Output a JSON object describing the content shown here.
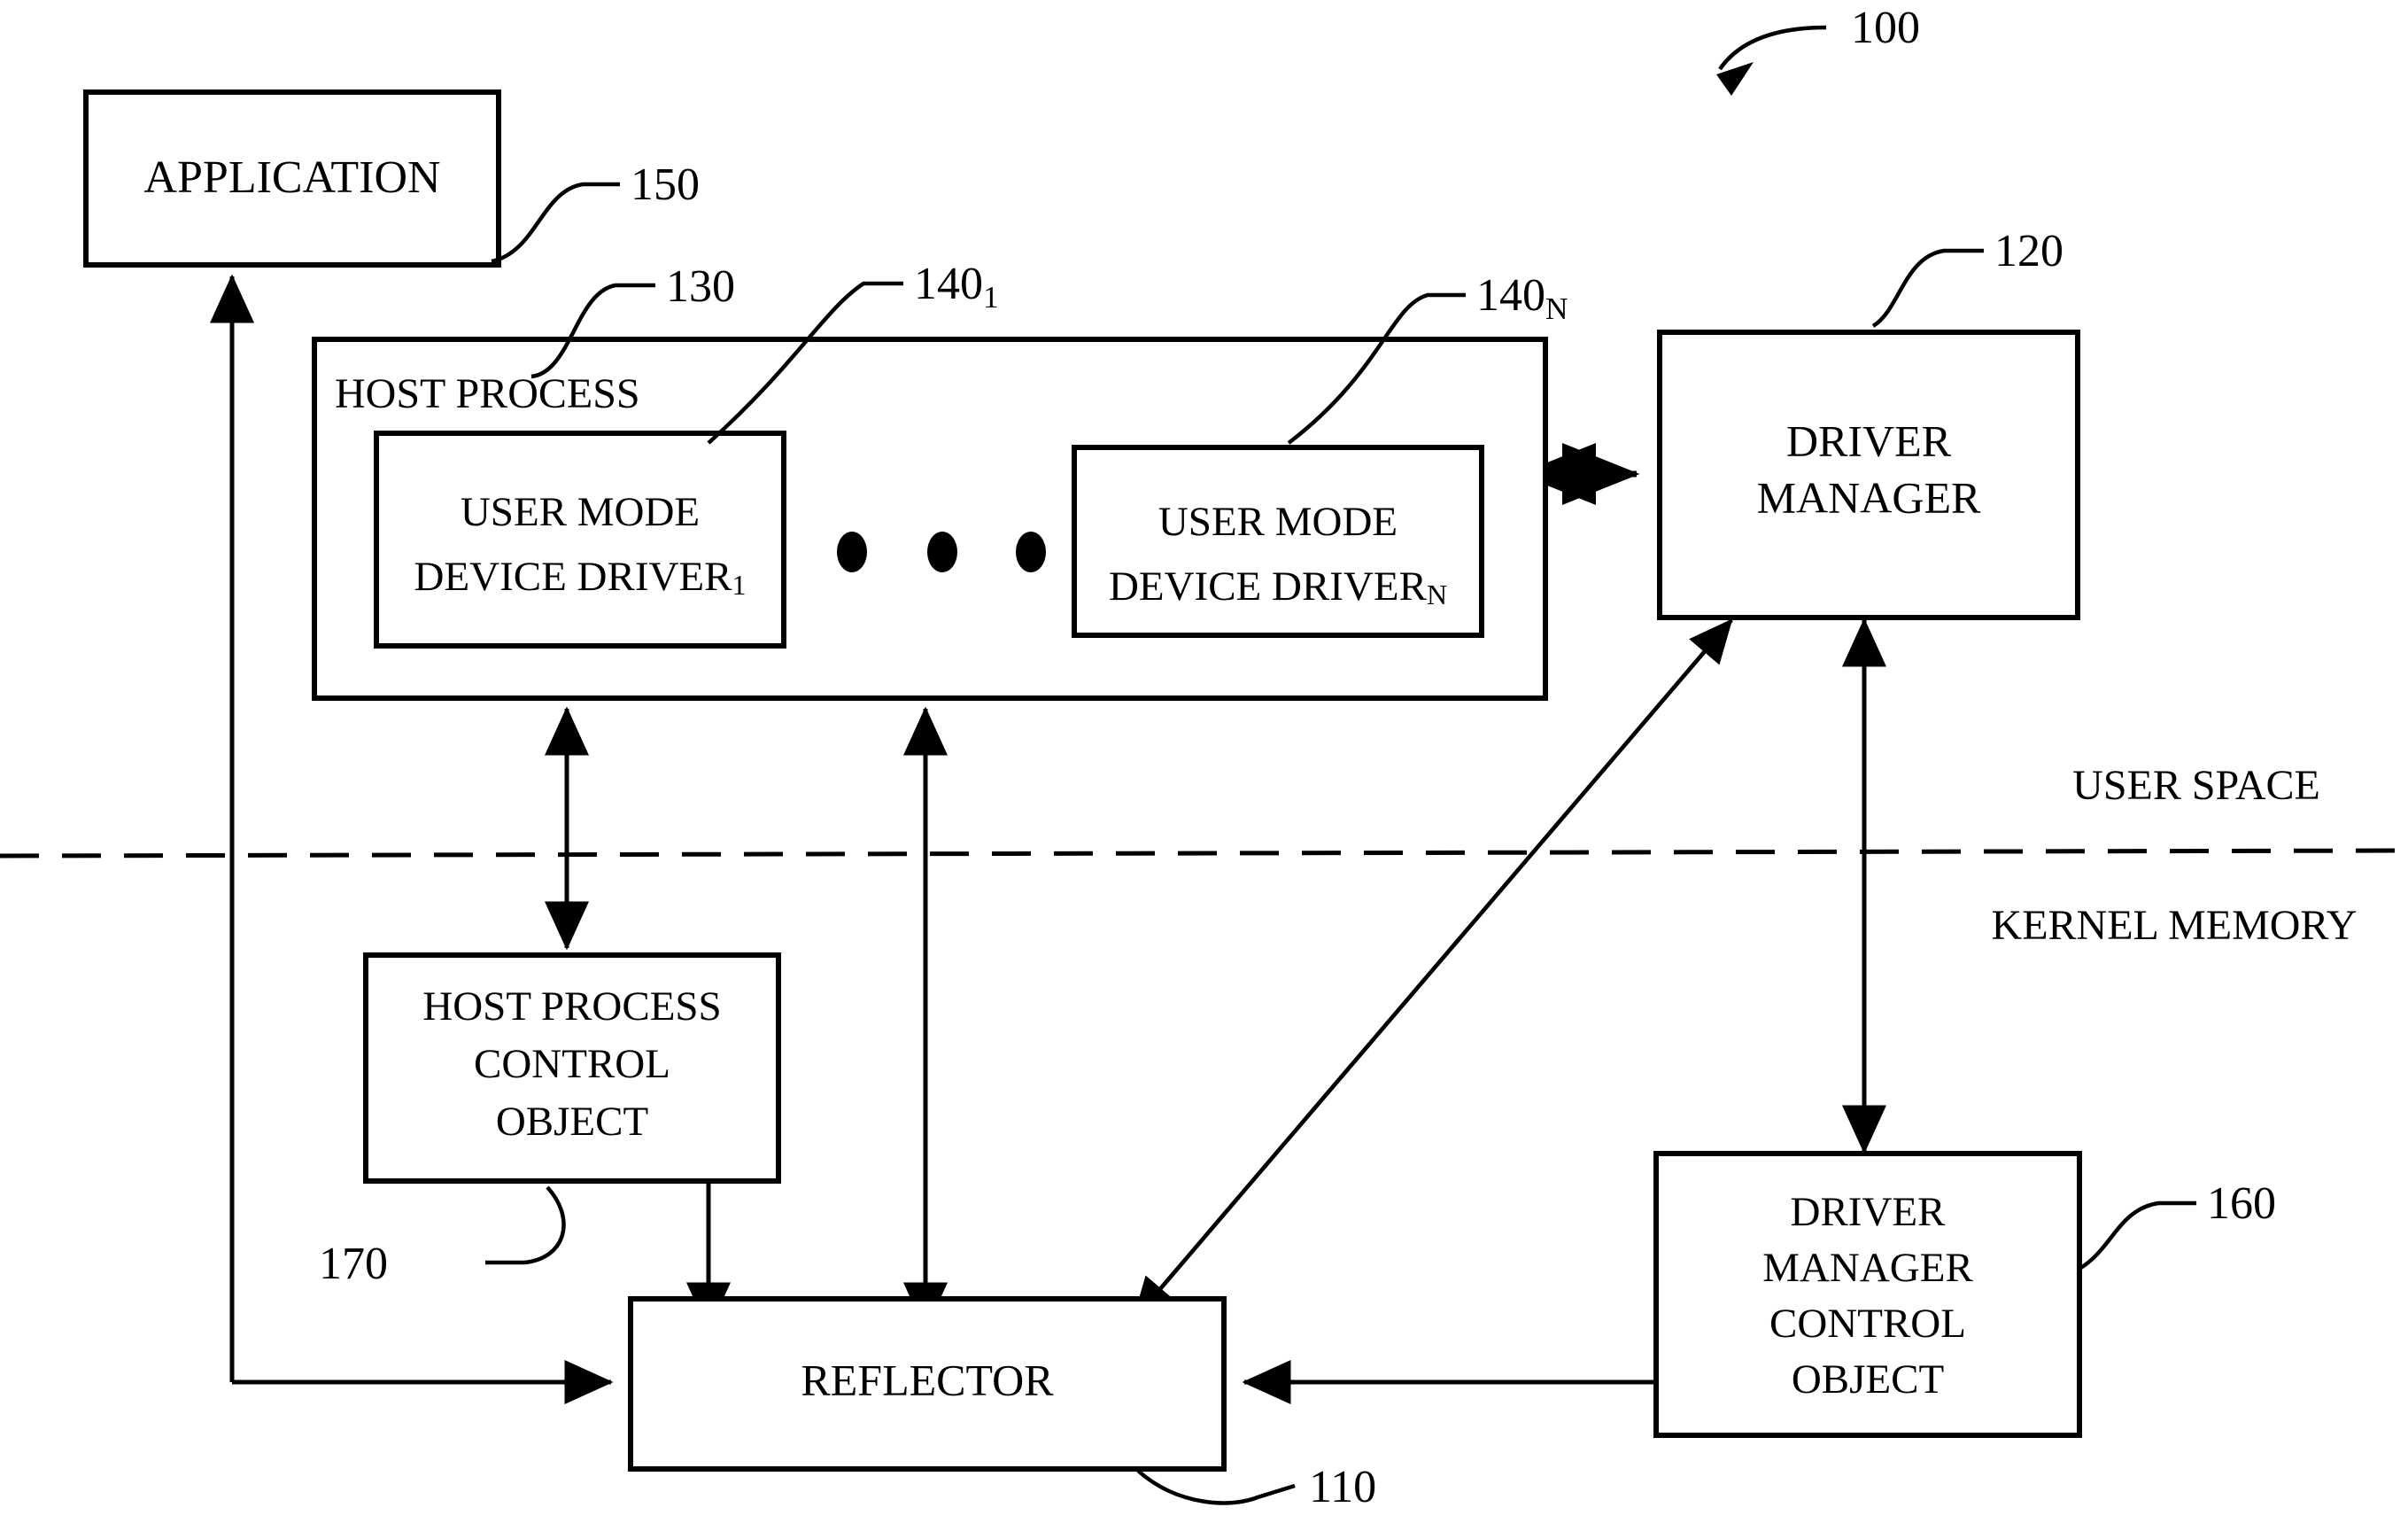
{
  "figure": {
    "figure_number": "100",
    "title": "",
    "boxes": {
      "application": {
        "label": "APPLICATION",
        "ref": "150"
      },
      "host_process": {
        "label": "HOST PROCESS",
        "ref": "130"
      },
      "user_mode_device_driver_1": {
        "label_line1": "USER MODE",
        "label_line2": "DEVICE DRIVER",
        "subscript": "1",
        "ref": "140",
        "ref_subscript": "1"
      },
      "user_mode_device_driver_n": {
        "label_line1": "USER MODE",
        "label_line2": "DEVICE DRIVER",
        "subscript": "N",
        "ref": "140",
        "ref_subscript": "N"
      },
      "driver_manager": {
        "label_line1": "DRIVER",
        "label_line2": "MANAGER",
        "ref": "120"
      },
      "host_process_control_object": {
        "label_line1": "HOST PROCESS",
        "label_line2": "CONTROL",
        "label_line3": "OBJECT",
        "ref": "170"
      },
      "reflector": {
        "label": "REFLECTOR",
        "ref": "110"
      },
      "driver_manager_control_object": {
        "label_line1": "DRIVER",
        "label_line2": "MANAGER",
        "label_line3": "CONTROL",
        "label_line4": "OBJECT",
        "ref": "160"
      }
    },
    "region_labels": {
      "user_space": "USER SPACE",
      "kernel_memory": "KERNEL MEMORY"
    },
    "ellipsis": "• • •",
    "colors": {
      "stroke": "#000000",
      "fill": "#ffffff",
      "text": "#000000"
    }
  }
}
